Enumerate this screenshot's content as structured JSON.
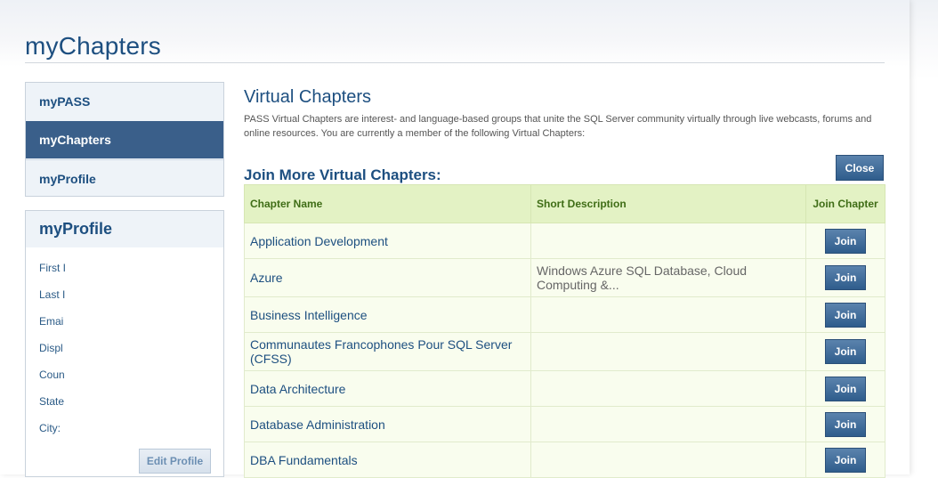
{
  "page": {
    "title": "myChapters"
  },
  "nav": {
    "items": [
      {
        "label": "myPASS",
        "active": false
      },
      {
        "label": "myChapters",
        "active": true
      },
      {
        "label": "myProfile",
        "active": false
      }
    ]
  },
  "profile": {
    "title": "myProfile",
    "fields": [
      "First I",
      "Last I",
      "Emai",
      "Displ",
      "Coun",
      "State",
      "City:"
    ],
    "edit_label": "Edit Profile"
  },
  "main": {
    "title": "Virtual Chapters",
    "description": "PASS Virtual Chapters are interest- and language-based groups that unite the SQL Server community virtually through live webcasts, forums and online resources. You are currently a member of the following Virtual Chapters:",
    "join_heading": "Join More Virtual Chapters:",
    "close_label": "Close"
  },
  "table": {
    "headers": {
      "name": "Chapter Name",
      "description": "Short Description",
      "join": "Join Chapter"
    },
    "join_label": "Join",
    "rows": [
      {
        "name": "Application Development",
        "description": ""
      },
      {
        "name": "Azure",
        "description": "Windows Azure SQL Database, Cloud Computing &..."
      },
      {
        "name": "Business Intelligence",
        "description": ""
      },
      {
        "name": "Communautes Francophones Pour SQL Server (CFSS)",
        "description": ""
      },
      {
        "name": "Data Architecture",
        "description": ""
      },
      {
        "name": "Database Administration",
        "description": ""
      },
      {
        "name": "DBA Fundamentals",
        "description": ""
      }
    ]
  },
  "colors": {
    "brand_blue": "#1d4f80",
    "nav_active": "#3a5f8a",
    "table_header": "#e3f2c4",
    "table_row": "#f9fdee",
    "button_blue": "#2f5d8c"
  }
}
